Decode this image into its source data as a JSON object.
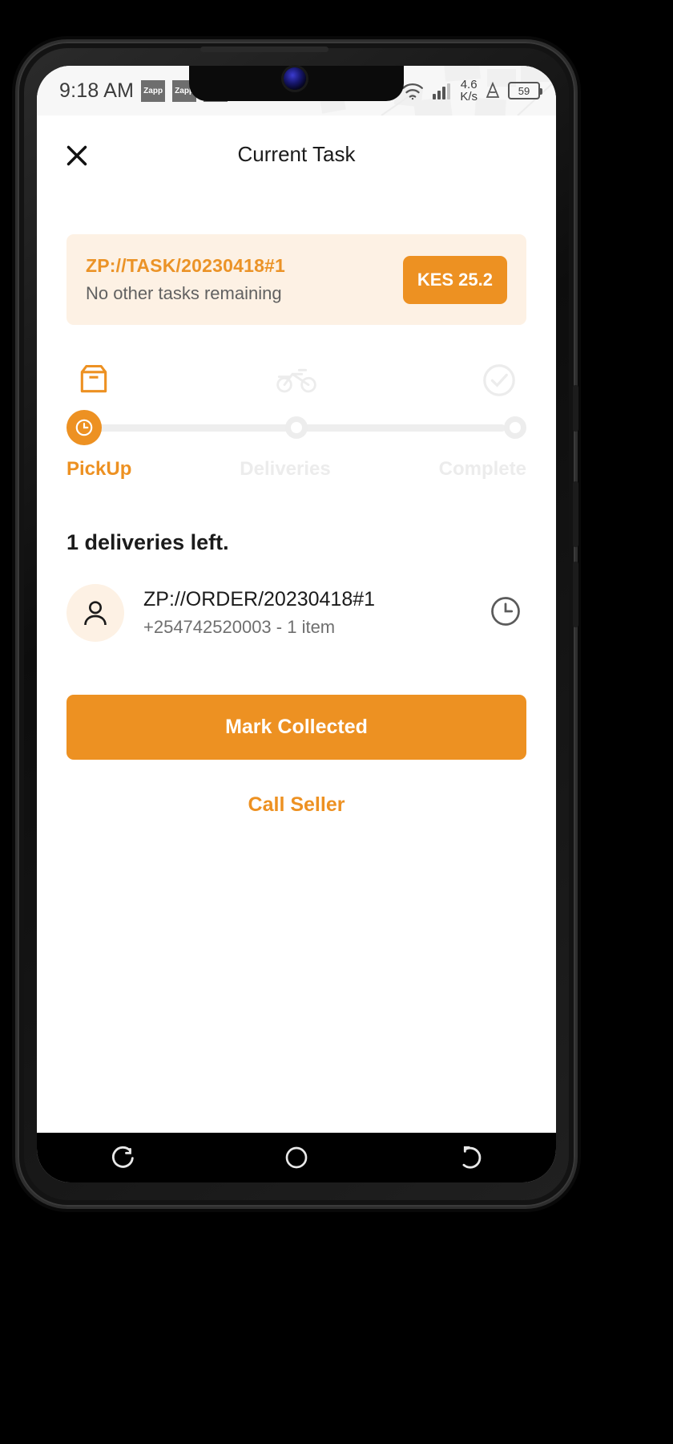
{
  "status_bar": {
    "time": "9:18 AM",
    "notifications": [
      {
        "name": "zapp-notification-1",
        "label": "Zapp"
      },
      {
        "name": "zapp-notification-2",
        "label": "Zapp"
      },
      {
        "name": "generic-notification",
        "label": ""
      }
    ],
    "icons": [
      "alarm-icon",
      "location-icon",
      "wifi-icon",
      "signal-icon",
      "vibrate-icon"
    ],
    "network_speed": "4.6",
    "network_speed_unit": "K/s",
    "battery_level": "59"
  },
  "appbar": {
    "title": "Current Task",
    "close_icon": "close-icon"
  },
  "task_card": {
    "task_id": "ZP://TASK/20230418#1",
    "subtitle": "No other tasks remaining",
    "amount": "KES 25.2"
  },
  "stepper": {
    "steps": [
      {
        "label": "PickUp",
        "icon": "box-icon",
        "state": "active",
        "node_icon": "clock-icon"
      },
      {
        "label": "Deliveries",
        "icon": "motorbike-icon",
        "state": "inactive",
        "node_icon": ""
      },
      {
        "label": "Complete",
        "icon": "check-circle-icon",
        "state": "inactive",
        "node_icon": ""
      }
    ]
  },
  "deliveries": {
    "heading": "1 deliveries left.",
    "orders": [
      {
        "order_id": "ZP://ORDER/20230418#1",
        "details": "+254742520003 - 1 item",
        "avatar_icon": "person-icon",
        "status_icon": "clock-icon"
      }
    ]
  },
  "actions": {
    "primary_label": "Mark Collected",
    "secondary_label": "Call Seller"
  },
  "nav_bar": {
    "buttons": [
      {
        "name": "recents-button",
        "icon": "recents-icon"
      },
      {
        "name": "home-button",
        "icon": "home-circle-icon"
      },
      {
        "name": "back-button",
        "icon": "back-icon"
      }
    ]
  },
  "colors": {
    "accent": "#ED9122",
    "accent_text": "#EB9327",
    "card_bg": "#FDF1E4",
    "muted": "#ECECEC",
    "text": "#1B1B1B",
    "subtext": "#6F6F6F"
  }
}
